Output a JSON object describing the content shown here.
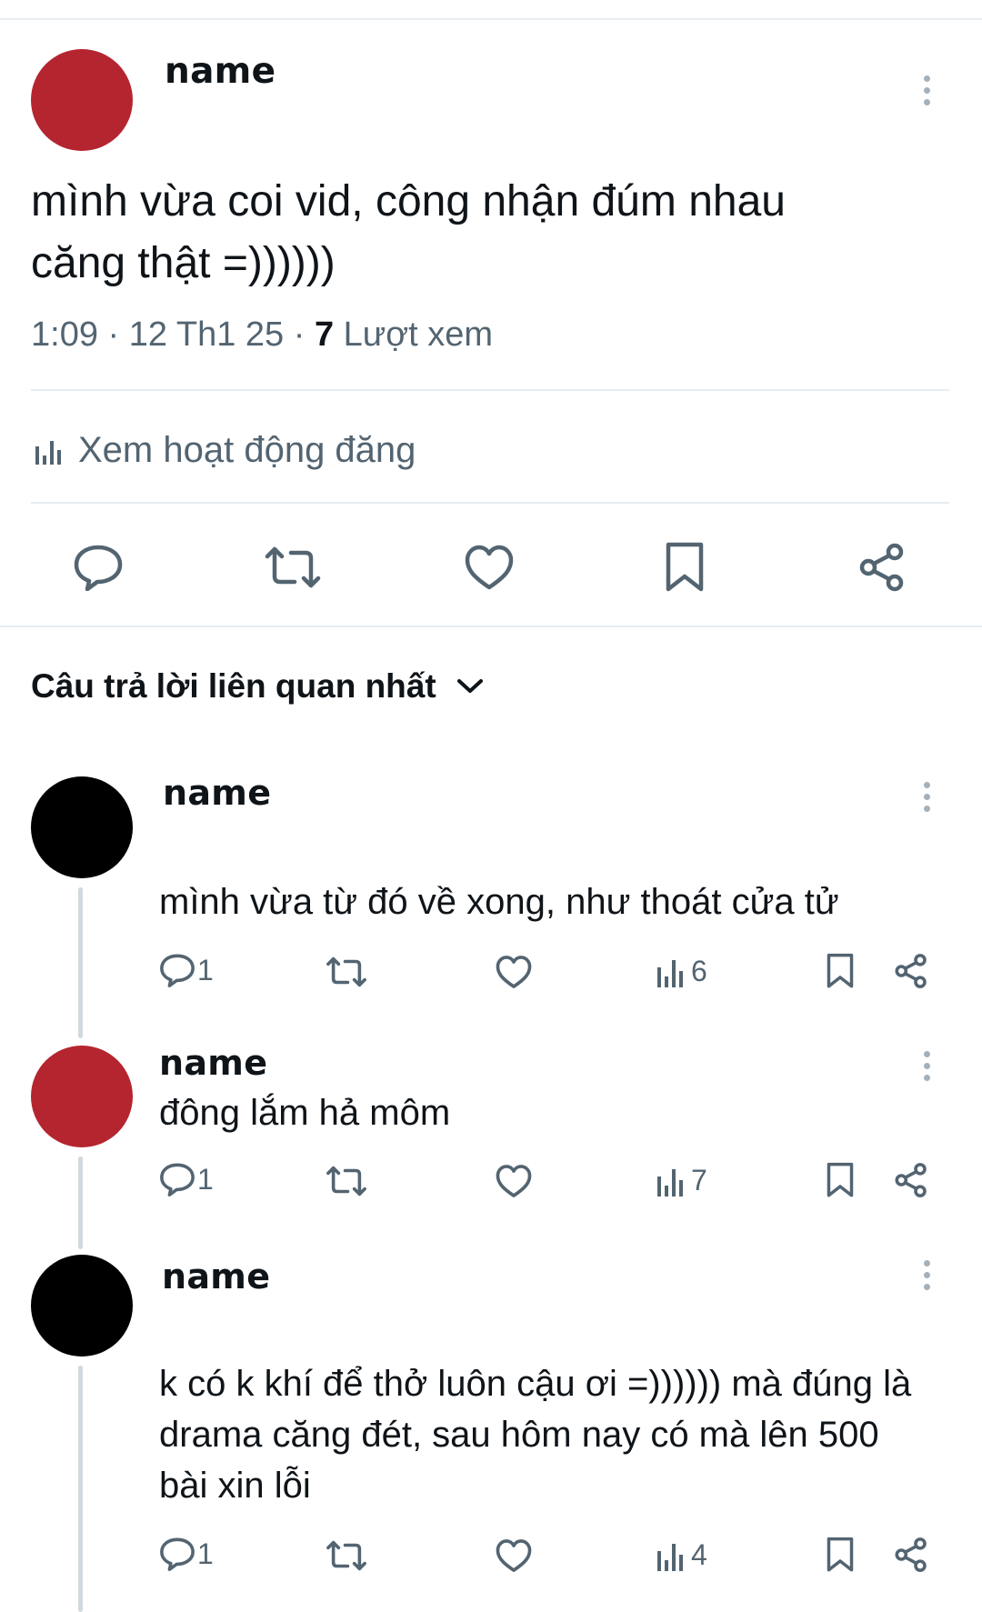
{
  "post": {
    "author": "name",
    "avatar_color": "#b5252f",
    "text_line1": "mình vừa coi vid, công nhận đúm nhau",
    "text_line2": "căng thật =))))))",
    "time": "1:09 · 12 Th1 25 · ",
    "views_count": "7",
    "views_label": " Lượt xem",
    "activity_label": "Xem hoạt động đăng"
  },
  "replies_header": {
    "label": "Câu trả lời liên quan nhất"
  },
  "replies": [
    {
      "author": "name",
      "avatar_color": "#000000",
      "text_lines": [
        "mình vừa từ đó về xong, như thoát cửa tử"
      ],
      "reply_count": "1",
      "views": "6"
    },
    {
      "author": "name",
      "avatar_color": "#b5252f",
      "text_lines": [
        "đông lắm hả môm"
      ],
      "reply_count": "1",
      "views": "7"
    },
    {
      "author": "name",
      "avatar_color": "#000000",
      "text_lines": [
        "k có k khí để thở luôn cậu ơi =)))))) mà đúng là",
        "drama căng đét, sau hôm nay có mà lên 500",
        "bài xin lỗi"
      ],
      "reply_count": "1",
      "views": "4"
    }
  ],
  "colors": {
    "icon_gray": "#536471",
    "divider": "#e6ecf0",
    "thread_line": "#cfd9de"
  },
  "icons": [
    "more-vertical-icon",
    "reply-icon",
    "retweet-icon",
    "like-icon",
    "bookmark-icon",
    "share-icon",
    "analytics-icon",
    "chevron-down-icon"
  ]
}
